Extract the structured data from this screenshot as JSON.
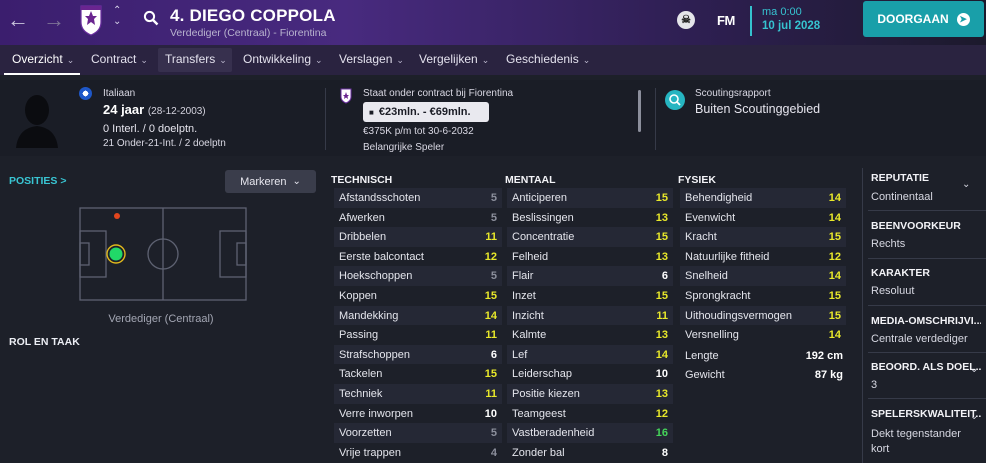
{
  "header": {
    "player_title": "4. DIEGO COPPOLA",
    "player_subtitle": "Verdediger (Centraal) - Fiorentina",
    "game_logo": "FM",
    "time": "ma 0:00",
    "date": "10 jul 2028",
    "continue_label": "DOORGAAN",
    "icons": [
      "back-arrow-icon",
      "forward-arrow-icon",
      "club-crest-icon",
      "up-down-icon",
      "search-icon",
      "skull-icon",
      "continue-arrow-icon"
    ]
  },
  "tabs": [
    {
      "label": "Overzicht"
    },
    {
      "label": "Contract"
    },
    {
      "label": "Transfers"
    },
    {
      "label": "Ontwikkeling"
    },
    {
      "label": "Verslagen"
    },
    {
      "label": "Vergelijken"
    },
    {
      "label": "Geschiedenis"
    }
  ],
  "info": {
    "nationality": "Italiaan",
    "age": "24 jaar",
    "birthdate": "(28-12-2003)",
    "caps": "0 Interl. / 0 doelptn.",
    "u21_caps": "21 Onder-21-Int. / 2 doelptn",
    "contract_status": "Staat onder contract bij Fiorentina",
    "value_range": "€23mln. - €69mln.",
    "wage": "€375K p/m tot 30-6-2032",
    "squad_status": "Belangrijke Speler",
    "scout_title": "Scoutingsrapport",
    "scout_value": "Buiten Scoutinggebied"
  },
  "left": {
    "positions_label": "POSITIES >",
    "mark_label": "Markeren",
    "position_caption": "Verdediger (Centraal)",
    "role_label": "ROL EN TAAK"
  },
  "attributes": {
    "technical": {
      "title": "TECHNISCH",
      "items": [
        {
          "name": "Afstandsschoten",
          "value": "5",
          "tone": "grey"
        },
        {
          "name": "Afwerken",
          "value": "5",
          "tone": "grey"
        },
        {
          "name": "Dribbelen",
          "value": "11",
          "tone": "yellow"
        },
        {
          "name": "Eerste balcontact",
          "value": "12",
          "tone": "yellow"
        },
        {
          "name": "Hoekschoppen",
          "value": "5",
          "tone": "grey"
        },
        {
          "name": "Koppen",
          "value": "15",
          "tone": "yellow"
        },
        {
          "name": "Mandekking",
          "value": "14",
          "tone": "yellow"
        },
        {
          "name": "Passing",
          "value": "11",
          "tone": "yellow"
        },
        {
          "name": "Strafschoppen",
          "value": "6",
          "tone": "white"
        },
        {
          "name": "Tackelen",
          "value": "15",
          "tone": "yellow"
        },
        {
          "name": "Techniek",
          "value": "11",
          "tone": "yellow"
        },
        {
          "name": "Verre inworpen",
          "value": "10",
          "tone": "white"
        },
        {
          "name": "Voorzetten",
          "value": "5",
          "tone": "grey"
        },
        {
          "name": "Vrije trappen",
          "value": "4",
          "tone": "grey"
        }
      ]
    },
    "mental": {
      "title": "MENTAAL",
      "items": [
        {
          "name": "Anticiperen",
          "value": "15",
          "tone": "yellow"
        },
        {
          "name": "Beslissingen",
          "value": "13",
          "tone": "yellow"
        },
        {
          "name": "Concentratie",
          "value": "15",
          "tone": "yellow"
        },
        {
          "name": "Felheid",
          "value": "13",
          "tone": "yellow"
        },
        {
          "name": "Flair",
          "value": "6",
          "tone": "white"
        },
        {
          "name": "Inzet",
          "value": "15",
          "tone": "yellow"
        },
        {
          "name": "Inzicht",
          "value": "11",
          "tone": "yellow"
        },
        {
          "name": "Kalmte",
          "value": "13",
          "tone": "yellow"
        },
        {
          "name": "Lef",
          "value": "14",
          "tone": "yellow"
        },
        {
          "name": "Leiderschap",
          "value": "10",
          "tone": "white"
        },
        {
          "name": "Positie kiezen",
          "value": "13",
          "tone": "yellow"
        },
        {
          "name": "Teamgeest",
          "value": "12",
          "tone": "yellow"
        },
        {
          "name": "Vastberadenheid",
          "value": "16",
          "tone": "green"
        },
        {
          "name": "Zonder bal",
          "value": "8",
          "tone": "white"
        }
      ]
    },
    "physical": {
      "title": "FYSIEK",
      "items": [
        {
          "name": "Behendigheid",
          "value": "14",
          "tone": "yellow"
        },
        {
          "name": "Evenwicht",
          "value": "14",
          "tone": "yellow"
        },
        {
          "name": "Kracht",
          "value": "15",
          "tone": "yellow"
        },
        {
          "name": "Natuurlijke fitheid",
          "value": "12",
          "tone": "yellow"
        },
        {
          "name": "Snelheid",
          "value": "14",
          "tone": "yellow"
        },
        {
          "name": "Sprongkracht",
          "value": "15",
          "tone": "yellow"
        },
        {
          "name": "Uithoudingsvermogen",
          "value": "15",
          "tone": "yellow"
        },
        {
          "name": "Versnelling",
          "value": "14",
          "tone": "yellow"
        }
      ],
      "height_label": "Lengte",
      "height_value": "192 cm",
      "weight_label": "Gewicht",
      "weight_value": "87 kg"
    }
  },
  "right": {
    "sections": [
      {
        "title": "REPUTATIE",
        "value": "Continentaal"
      },
      {
        "title": "BEENVOORKEUR",
        "value": "Rechts"
      },
      {
        "title": "KARAKTER",
        "value": "Resoluut"
      },
      {
        "title": "MEDIA-OMSCHRIJVI...",
        "value": "Centrale verdediger"
      },
      {
        "title": "BEOORD. ALS DOEL...",
        "value": "3"
      },
      {
        "title": "SPELERSKWALITEIT...",
        "value": "Dekt tegenstander",
        "value2": "kort"
      }
    ]
  },
  "colors": {
    "accent": "#199fa9",
    "tab_bar": "#2a2340",
    "value_yellow": "#e8e82a",
    "value_green": "#45d45a",
    "value_grey": "#8c8f9c"
  }
}
